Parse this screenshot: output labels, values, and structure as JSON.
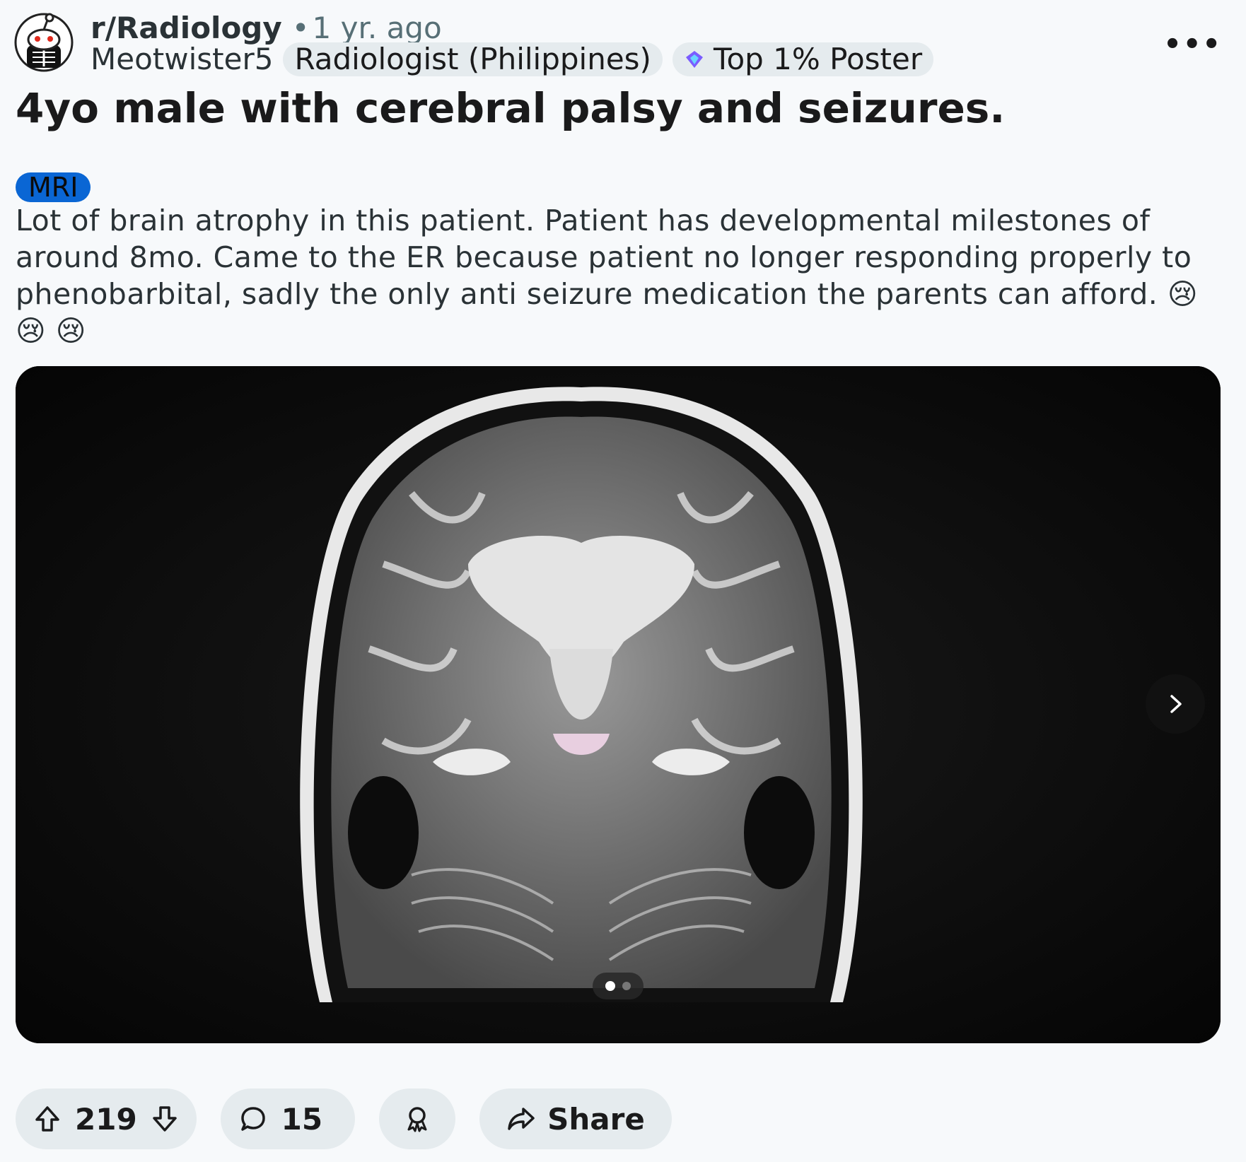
{
  "header": {
    "subreddit": "r/Radiology",
    "separator": "•",
    "age": "1 yr. ago",
    "username": "Meotwister5",
    "user_flair": "Radiologist (Philippines)",
    "achievement_badge": "Top 1% Poster",
    "more_icon": "ellipsis-icon"
  },
  "post": {
    "title": "4yo male with cerebral palsy and seizures.",
    "flair": "MRI",
    "body": "Lot of brain atrophy in this patient. Patient has developmental milestones of around 8mo. Came to the ER because patient no longer responding properly to phenobarbital, sadly the only anti seizure medication the parents can afford. 😢 😢 😢"
  },
  "media": {
    "image_count": 2,
    "current_index": 1
  },
  "actions": {
    "upvote_icon": "upvote-arrow-icon",
    "score": "219",
    "downvote_icon": "downvote-arrow-icon",
    "comment_icon": "speech-bubble-icon",
    "comments": "15",
    "award_icon": "award-ribbon-icon",
    "share_icon": "share-arrow-icon",
    "share_label": "Share"
  },
  "colors": {
    "background": "#f7f9fb",
    "pill_background": "#e5ebee",
    "flair_blue": "#0a66d4"
  }
}
